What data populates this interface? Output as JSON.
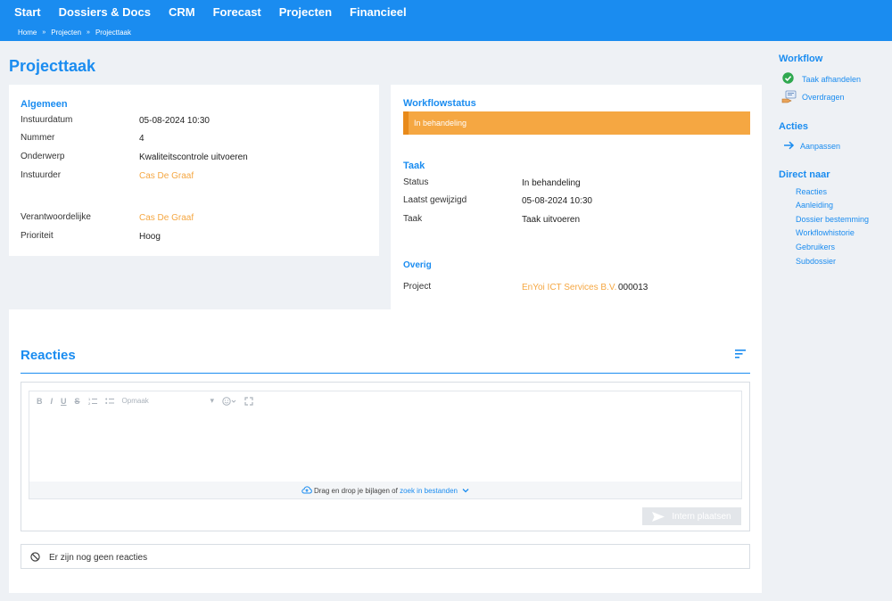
{
  "nav": {
    "items": [
      "Start",
      "Dossiers & Docs",
      "CRM",
      "Forecast",
      "Projecten",
      "Financieel"
    ],
    "breadcrumb": [
      "Home",
      "Projecten",
      "Projecttaak"
    ]
  },
  "page": {
    "title": "Projecttaak"
  },
  "algemeen": {
    "title": "Algemeen",
    "fields": {
      "instuurdatum": {
        "label": "Instuurdatum",
        "value": "05-08-2024 10:30"
      },
      "nummer": {
        "label": "Nummer",
        "value": "4"
      },
      "onderwerp": {
        "label": "Onderwerp",
        "value": "Kwaliteitscontrole uitvoeren"
      },
      "instuurder": {
        "label": "Instuurder",
        "value": "Cas De Graaf"
      },
      "verantwoordelijke": {
        "label": "Verantwoordelijke",
        "value": "Cas De Graaf"
      },
      "prioriteit": {
        "label": "Prioriteit",
        "value": "Hoog"
      }
    }
  },
  "workflowstatus": {
    "title": "Workflowstatus",
    "status": "In behandeling"
  },
  "taak": {
    "title": "Taak",
    "fields": {
      "status": {
        "label": "Status",
        "value": "In behandeling"
      },
      "laatst": {
        "label": "Laatst gewijzigd",
        "value": "05-08-2024 10:30"
      },
      "taak": {
        "label": "Taak",
        "value": "Taak uitvoeren"
      }
    }
  },
  "overig": {
    "title": "Overig",
    "project": {
      "label": "Project",
      "link": "EnYoi ICT Services B.V.",
      "code": "000013"
    }
  },
  "reacties": {
    "title": "Reacties",
    "toolbar": {
      "bold": "B",
      "italic": "I",
      "underline": "U",
      "strike": "S",
      "format": "Opmaak"
    },
    "dropzone": {
      "text": "Drag en drop je bijlagen of",
      "link": "zoek in bestanden"
    },
    "post_button": "Intern plaatsen",
    "empty": "Er zijn nog geen reacties"
  },
  "sidebar": {
    "workflow": {
      "title": "Workflow",
      "afhandelen": "Taak afhandelen",
      "overdragen": "Overdragen"
    },
    "acties": {
      "title": "Acties",
      "aanpassen": "Aanpassen"
    },
    "direct": {
      "title": "Direct naar",
      "links": [
        "Reacties",
        "Aanleiding",
        "Dossier bestemming",
        "Workflowhistorie",
        "Gebruikers",
        "Subdossier"
      ]
    }
  },
  "colors": {
    "primary": "#1a8cf0",
    "accent": "#f5a742",
    "background": "#eef1f5"
  }
}
